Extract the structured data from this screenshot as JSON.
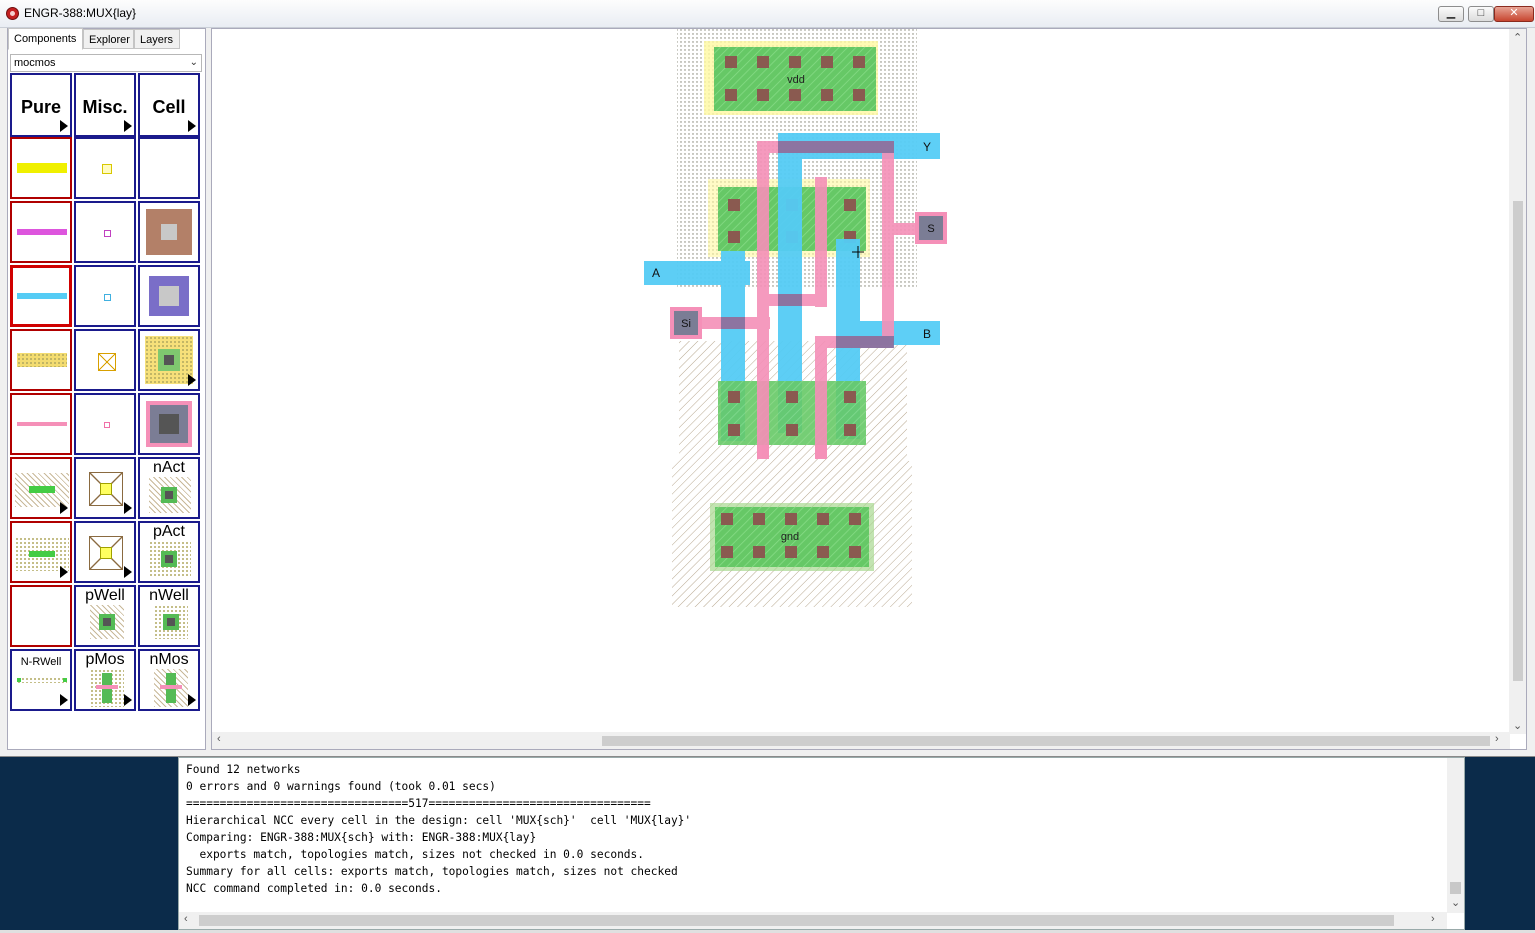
{
  "window": {
    "title": "ENGR-388:MUX{lay}",
    "minimize": "▁",
    "maximize": "□",
    "close": "✕"
  },
  "tabs": [
    {
      "label": "Components"
    },
    {
      "label": "Explorer"
    },
    {
      "label": "Layers"
    }
  ],
  "technology": {
    "selected": "mocmos"
  },
  "palette": {
    "headers": [
      "Pure",
      "Misc.",
      "Cell"
    ],
    "labels": {
      "nAct": "nAct",
      "pAct": "pAct",
      "pWell": "pWell",
      "nWell": "nWell",
      "nRWell": "N-RWell",
      "pMos": "pMos",
      "nMos": "nMos"
    },
    "colors": {
      "metal1": "#ffff00",
      "metal2": "#e050e0",
      "metal3": "#55ccf5",
      "poly": "#f590b8",
      "active": "#66cc66"
    }
  },
  "layout": {
    "labels": {
      "vdd": "vdd",
      "gnd": "gnd",
      "A": "A",
      "B": "B",
      "Y": "Y",
      "S": "S",
      "Si": "Si"
    }
  },
  "console": {
    "lines": [
      "Found 12 networks",
      "0 errors and 0 warnings found (took 0.01 secs)",
      "=================================517=================================",
      "Hierarchical NCC every cell in the design: cell 'MUX{sch}'  cell 'MUX{lay}'",
      "Comparing: ENGR-388:MUX{sch} with: ENGR-388:MUX{lay}",
      "  exports match, topologies match, sizes not checked in 0.0 seconds.",
      "Summary for all cells: exports match, topologies match, sizes not checked",
      "NCC command completed in: 0.0 seconds."
    ]
  }
}
